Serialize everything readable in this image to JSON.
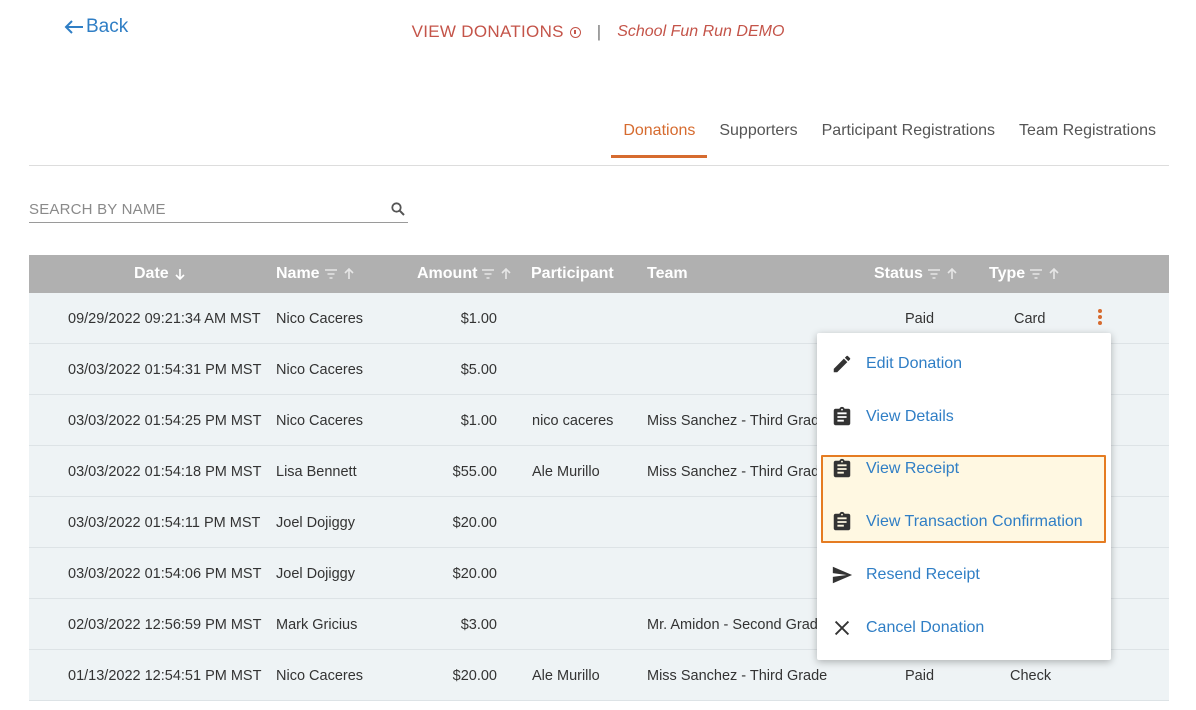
{
  "nav": {
    "back_label": "Back"
  },
  "header": {
    "title": "VIEW DONATIONS",
    "separator": "|",
    "event_name": "School Fun Run DEMO"
  },
  "tabs": [
    {
      "label": "Donations",
      "active": true
    },
    {
      "label": "Supporters",
      "active": false
    },
    {
      "label": "Participant Registrations",
      "active": false
    },
    {
      "label": "Team Registrations",
      "active": false
    }
  ],
  "search": {
    "placeholder": "SEARCH BY NAME"
  },
  "table": {
    "columns": [
      "Date",
      "Name",
      "Amount",
      "Participant",
      "Team",
      "Status",
      "Type"
    ],
    "rows": [
      {
        "date": "09/29/2022 09:21:34 AM MST",
        "name": "Nico Caceres",
        "amount": "$1.00",
        "participant": "",
        "team": "",
        "status": "Paid",
        "type": "Card"
      },
      {
        "date": "03/03/2022 01:54:31 PM MST",
        "name": "Nico Caceres",
        "amount": "$5.00",
        "participant": "",
        "team": "",
        "status": "",
        "type": ""
      },
      {
        "date": "03/03/2022 01:54:25 PM MST",
        "name": "Nico Caceres",
        "amount": "$1.00",
        "participant": "nico caceres",
        "team": "Miss Sanchez - Third Grad",
        "status": "",
        "type": ""
      },
      {
        "date": "03/03/2022 01:54:18 PM MST",
        "name": "Lisa Bennett",
        "amount": "$55.00",
        "participant": "Ale Murillo",
        "team": "Miss Sanchez - Third Grad",
        "status": "",
        "type": ""
      },
      {
        "date": "03/03/2022 01:54:11 PM MST",
        "name": "Joel Dojiggy",
        "amount": "$20.00",
        "participant": "",
        "team": "",
        "status": "",
        "type": ""
      },
      {
        "date": "03/03/2022 01:54:06 PM MST",
        "name": "Joel Dojiggy",
        "amount": "$20.00",
        "participant": "",
        "team": "",
        "status": "",
        "type": ""
      },
      {
        "date": "02/03/2022 12:56:59 PM MST",
        "name": "Mark Gricius",
        "amount": "$3.00",
        "participant": "",
        "team": "Mr. Amidon - Second Grad",
        "status": "",
        "type": ""
      },
      {
        "date": "01/13/2022 12:54:51 PM MST",
        "name": "Nico Caceres",
        "amount": "$20.00",
        "participant": "Ale Murillo",
        "team": "Miss Sanchez - Third Grade",
        "status": "Paid",
        "type": "Check"
      }
    ]
  },
  "menu": {
    "items": [
      {
        "label": "Edit Donation",
        "icon": "pencil-icon"
      },
      {
        "label": "View Details",
        "icon": "clipboard-icon"
      },
      {
        "label": "View Receipt",
        "icon": "clipboard-icon"
      },
      {
        "label": "View Transaction Confirmation",
        "icon": "clipboard-icon"
      },
      {
        "label": "Resend Receipt",
        "icon": "send-icon"
      },
      {
        "label": "Cancel Donation",
        "icon": "close-icon"
      }
    ]
  },
  "colors": {
    "accent": "#d66b2f",
    "link": "#2f7ec5",
    "title": "#c45449",
    "highlight_border": "#e57c22",
    "header_bg": "#b0b0b0",
    "row_bg": "#eef3f5"
  }
}
